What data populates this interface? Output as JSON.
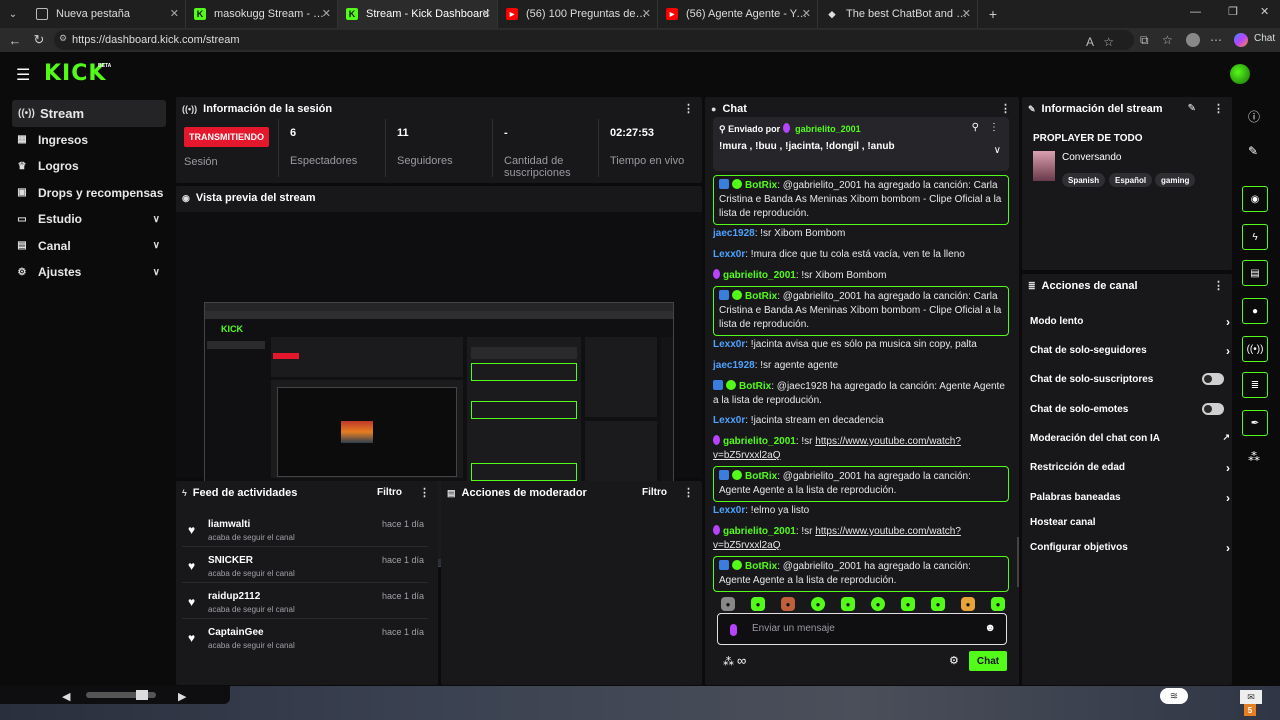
{
  "browser": {
    "tabs": [
      {
        "title": "Nueva pestaña"
      },
      {
        "title": "masokugg Stream - Watch Liv"
      },
      {
        "title": "Stream - Kick Dashboard"
      },
      {
        "title": "(56) 100 Preguntas de CULTURA G"
      },
      {
        "title": "(56) Agente Agente - YouTube"
      },
      {
        "title": "The best ChatBot and Widgets for"
      }
    ],
    "url": "https://dashboard.kick.com/stream",
    "chat_label": "Chat"
  },
  "app": {
    "logo": "KICK",
    "beta": "BETA"
  },
  "sidebar": {
    "items": [
      {
        "label": "Stream"
      },
      {
        "label": "Ingresos"
      },
      {
        "label": "Logros"
      },
      {
        "label": "Drops y recompensas"
      },
      {
        "label": "Estudio"
      },
      {
        "label": "Canal"
      },
      {
        "label": "Ajustes"
      }
    ]
  },
  "session": {
    "title": "Información de la sesión",
    "live_badge": "TRANSMITIENDO",
    "session_label": "Sesión",
    "viewers_value": "6",
    "viewers_label": "Espectadores",
    "followers_value": "11",
    "followers_label": "Seguidores",
    "subs_value": "-",
    "subs_label_1": "Cantidad de",
    "subs_label_2": "suscripciones",
    "live_time_value": "02:27:53",
    "live_time_label": "Tiempo en vivo"
  },
  "preview": {
    "title": "Vista previa del stream"
  },
  "feed": {
    "title": "Feed de actividades",
    "filter": "Filtro",
    "items": [
      {
        "name": "liamwalti",
        "sub": "acaba de seguir el canal",
        "time": "hace 1 día"
      },
      {
        "name": "SNICKER",
        "sub": "acaba de seguir el canal",
        "time": "hace 1 día"
      },
      {
        "name": "raidup2112",
        "sub": "acaba de seguir el canal",
        "time": "hace 1 día"
      },
      {
        "name": "CaptainGee",
        "sub": "acaba de seguir el canal",
        "time": "hace 1 día"
      }
    ]
  },
  "mod": {
    "title": "Acciones de moderador",
    "filter": "Filtro"
  },
  "chat": {
    "title": "Chat",
    "pinned_by": "Enviado por",
    "pinned_user": "gabrielito_2001",
    "pinned_text": "!mura , !buu , !jacinta, !dongil , !anub",
    "m1_user": "BotRix",
    "m1_text": ": @gabrielito_2001 ha agregado la canción: Carla Cristina e Banda As Meninas Xibom bombom - Clipe Oficial a la lista de reprodución.",
    "m2_user": "jaec1928",
    "m2_text": ": !sr Xibom Bombom",
    "m3_user": "Lexx0r",
    "m3_text": ": !mura dice que tu cola está vacía, ven te la lleno",
    "m4_user": "gabrielito_2001",
    "m4_text": ": !sr Xibom Bombom",
    "m5_user": "BotRix",
    "m5_text": ": @gabrielito_2001 ha agregado la canción: Carla Cristina e Banda As Meninas Xibom bombom - Clipe Oficial a la lista de reprodución.",
    "m6_user": "Lexx0r",
    "m6_text": ": !jacinta avisa que es sólo pa musica sin copy, palta",
    "m7_user": "jaec1928",
    "m7_text": ": !sr agente agente",
    "m8_user": "BotRix",
    "m8_text": ": @jaec1928 ha agregado la canción: Agente Agente a la lista de reprodución.",
    "m9_user": "Lexx0r",
    "m9_text": ": !jacinta stream en decadencia",
    "m10_user": "gabrielito_2001",
    "m10_pre": ": !sr ",
    "m10_link": "https://www.youtube.com/watch?v=bZ5rvxxl2aQ",
    "m11_user": "BotRix",
    "m11_text": ": @gabrielito_2001 ha agregado la canción: Agente Agente a la lista de reprodución.",
    "m12_user": "Lexx0r",
    "m12_text": ": !elmo ya listo",
    "m13_user": "gabrielito_2001",
    "m13_pre": ": !sr ",
    "m13_link": "https://www.youtube.com/watch?v=bZ5rvxxl2aQ",
    "m14_user": "BotRix",
    "m14_text": ": @gabrielito_2001 ha agregado la canción: Agente Agente a la lista de reprodución.",
    "input_placeholder": "Enviar un mensaje",
    "send_label": "Chat"
  },
  "stream_info": {
    "title": "Información del stream",
    "stream_title": "PROPLAYER DE TODO",
    "category": "Conversando",
    "tags": [
      "Spanish",
      "Español",
      "gaming"
    ]
  },
  "channel_actions": {
    "title": "Acciones de canal",
    "items": [
      {
        "label": "Modo lento"
      },
      {
        "label": "Chat de solo-seguidores"
      },
      {
        "label": "Chat de solo-suscriptores"
      },
      {
        "label": "Chat de solo-emotes"
      },
      {
        "label": "Moderación del chat con IA"
      },
      {
        "label": "Restricción de edad"
      },
      {
        "label": "Palabras baneadas"
      },
      {
        "label": "Hostear canal"
      },
      {
        "label": "Configurar objetivos"
      }
    ]
  },
  "taskbar": {
    "badge": "5"
  },
  "colors": {
    "accent": "#53fc18",
    "live": "#e5172d",
    "panel": "#18181b"
  }
}
